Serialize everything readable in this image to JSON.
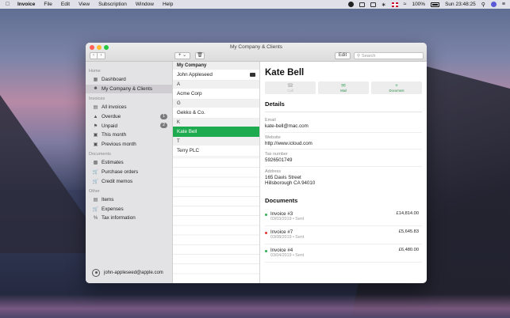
{
  "menubar": {
    "items": [
      "Invoice",
      "File",
      "Edit",
      "View",
      "Subscription",
      "Window",
      "Help"
    ],
    "battery": "100%",
    "clock": "Sun 23:48:25"
  },
  "window": {
    "title": "My Company & Clients",
    "toolbar": {
      "add": "+",
      "edit_label": "Edit",
      "search_placeholder": "Search"
    }
  },
  "sidebar": {
    "sections": [
      {
        "label": "Home",
        "items": [
          {
            "label": "Dashboard",
            "icon": "dashboard-icon"
          },
          {
            "label": "My Company & Clients",
            "icon": "people-icon",
            "selected": true
          }
        ]
      },
      {
        "label": "Invoices",
        "items": [
          {
            "label": "All invoices",
            "icon": "invoice-icon"
          },
          {
            "label": "Overdue",
            "icon": "warning-icon",
            "badge": "1"
          },
          {
            "label": "Unpaid",
            "icon": "flag-icon",
            "badge": "2"
          },
          {
            "label": "This month",
            "icon": "calendar-icon"
          },
          {
            "label": "Previous month",
            "icon": "calendar-icon"
          }
        ]
      },
      {
        "label": "Documents",
        "items": [
          {
            "label": "Estimates",
            "icon": "estimate-icon"
          },
          {
            "label": "Purchase orders",
            "icon": "cart-icon"
          },
          {
            "label": "Credit memos",
            "icon": "cart-icon"
          }
        ]
      },
      {
        "label": "Other",
        "items": [
          {
            "label": "Items",
            "icon": "items-icon"
          },
          {
            "label": "Expenses",
            "icon": "cart-icon"
          },
          {
            "label": "Tax information",
            "icon": "percent-icon"
          }
        ]
      }
    ],
    "account": "john-appleseed@apple.com"
  },
  "list": {
    "header": "My Company",
    "company": "John Appleseed",
    "groups": [
      {
        "letter": "A",
        "rows": [
          "Acme Corp"
        ]
      },
      {
        "letter": "G",
        "rows": [
          "Gekko & Co."
        ]
      },
      {
        "letter": "K",
        "rows": [
          "Kate Bell"
        ]
      },
      {
        "letter": "T",
        "rows": [
          "Terry PLC"
        ]
      }
    ],
    "selected": "Kate Bell"
  },
  "detail": {
    "name": "Kate Bell",
    "actions": [
      {
        "label": "Call",
        "icon": "phone-icon",
        "disabled": true
      },
      {
        "label": "Mail",
        "icon": "mail-icon",
        "disabled": false
      },
      {
        "label": "Document",
        "icon": "plus-icon",
        "disabled": false
      }
    ],
    "details_title": "Details",
    "fields": [
      {
        "label": "Email",
        "value": "kate-bell@mac.com"
      },
      {
        "label": "Website",
        "value": "http://www.icloud.com"
      },
      {
        "label": "Tax number",
        "value": "5926501749"
      },
      {
        "label": "Address",
        "value": "165 Davis Street",
        "value2": "Hillsborough CA 94010"
      }
    ],
    "documents_title": "Documents",
    "documents": [
      {
        "name": "Invoice #3",
        "meta": "03/03/2019 • Sent",
        "amount": "£14,814.00",
        "status_color": "#2fb24f"
      },
      {
        "name": "Invoice #7",
        "meta": "03/08/2019 • Sent",
        "amount": "£5,645.83",
        "status_color": "#e3342f"
      },
      {
        "name": "Invoice #4",
        "meta": "03/04/2019 • Sent",
        "amount": "£6,480.00",
        "status_color": "#2fb24f"
      }
    ]
  }
}
